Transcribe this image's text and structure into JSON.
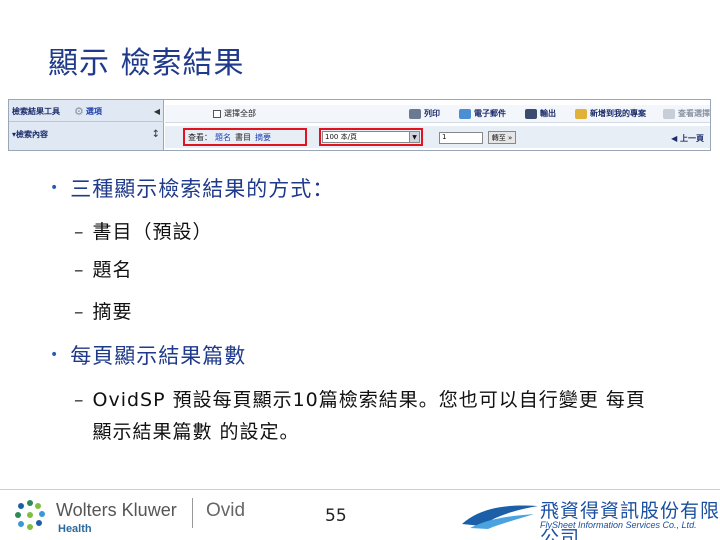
{
  "slide": {
    "title": "顯示  檢索結果"
  },
  "screenshot": {
    "left_panel": {
      "header_label": "檢索結果工具",
      "options_label": "選項",
      "collapse_arrow": "◀",
      "section_label": "▾檢索內容",
      "sort_icon": "↕"
    },
    "toolbar": {
      "select_all_label": "選擇全部",
      "print_label": "列印",
      "email_label": "電子郵件",
      "export_label": "輸出",
      "add_to_project_label": "新增到我的專案",
      "view_selected_label": "查看選擇"
    },
    "view_bar": {
      "view_label": "查看：",
      "view_options": [
        "題名",
        "書目",
        "摘要"
      ],
      "per_page_value": "100 本/頁",
      "page_input_value": "1",
      "go_label": "轉至 »",
      "prev_label": "◀ 上一頁"
    }
  },
  "content": {
    "bullet1": "三種顯示檢索結果的方式：",
    "sub1": [
      "書目（預設）",
      "題名",
      "摘要"
    ],
    "bullet2": "每頁顯示結果篇數",
    "sub2_text": "OvidSP 預設每頁顯示10篇檢索結果。您也可以自行變更 每頁顯示結果篇數 的設定。",
    "dash": "–",
    "bullet_glyph": "•"
  },
  "footer": {
    "brand_name": "Wolters Kluwer",
    "brand_sub": "Health",
    "product": "Ovid",
    "page_number": "55",
    "partner_cn": "飛資得資訊股份有限公司",
    "partner_en": "FlySheet Information Services Co., Ltd."
  },
  "colors": {
    "title": "#1f3a8a",
    "highlight_box": "#e0141e",
    "panel_bg": "#dfe8f3"
  }
}
